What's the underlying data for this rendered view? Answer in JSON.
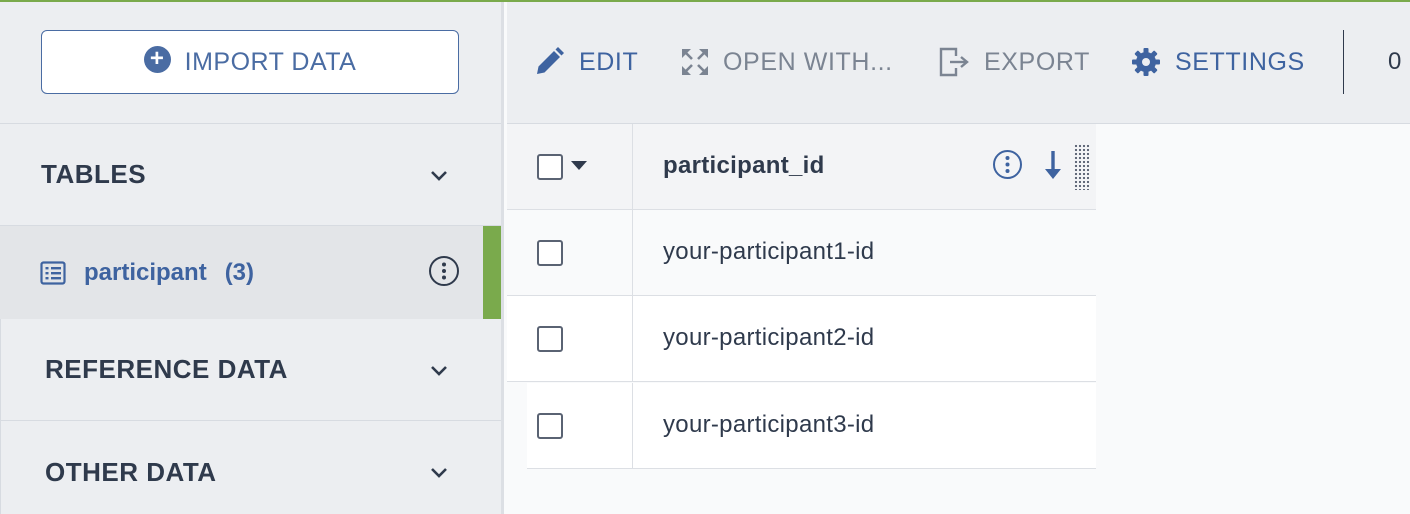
{
  "sidebar": {
    "import_label": "IMPORT DATA",
    "sections": {
      "tables": "TABLES",
      "reference": "REFERENCE DATA",
      "other": "OTHER DATA"
    },
    "active_table": {
      "name": "participant",
      "count": "(3)"
    }
  },
  "toolbar": {
    "edit": "EDIT",
    "open_with": "OPEN WITH...",
    "export": "EXPORT",
    "settings": "SETTINGS",
    "selected_count": "0"
  },
  "grid": {
    "column_header": "participant_id",
    "rows": [
      "your-participant1-id",
      "your-participant2-id",
      "your-participant3-id"
    ]
  },
  "colors": {
    "accent_blue": "#3e63a0",
    "active_green": "#7aaa4c",
    "text_dark": "#2f3a4c",
    "muted_gray": "#7b8492"
  }
}
